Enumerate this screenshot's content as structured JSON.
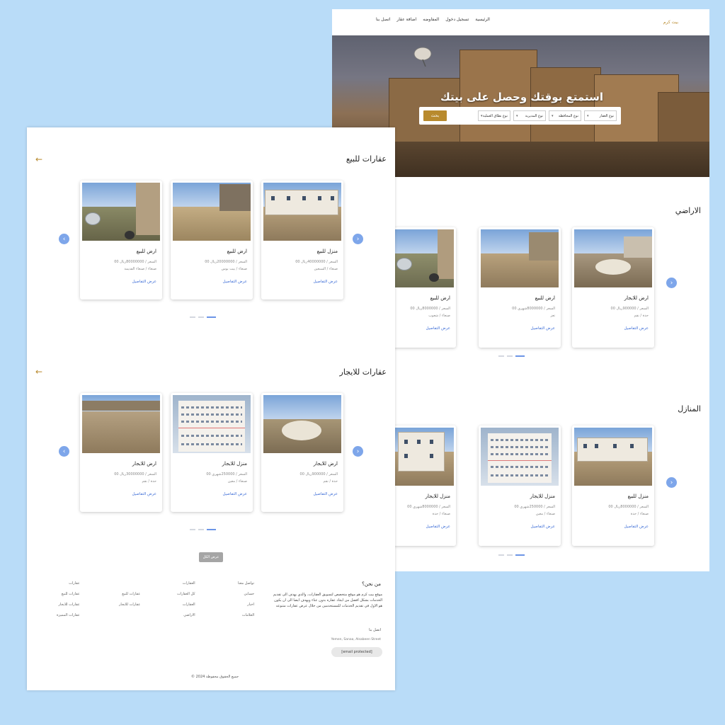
{
  "header": {
    "brand": "بيت كرم",
    "menu": [
      "الرئيسية",
      "تسجيل دخول",
      "المفاوضه",
      "اضافة عقار",
      "اتصل بنا"
    ]
  },
  "hero": {
    "title": "استمتع بوقتك وحصل على بيتك",
    "filters": [
      "نوع العقار",
      "نوع المحافظة",
      "نوع المديرية",
      "نوع نطاق العملية"
    ],
    "search_label": "بحث"
  },
  "back_sections": {
    "lands": {
      "title": "الاراضي",
      "cards": [
        {
          "title": "ارض للايجار",
          "price": "السعر / 900000ريال 00",
          "location": "حدة / نقم",
          "link": "عرض التفاصيل"
        },
        {
          "title": "ارض للبيع",
          "price": "السعر / 8000000شهري 00",
          "location": "تعز",
          "link": "عرض التفاصيل"
        },
        {
          "title": "ارض للبيع",
          "price": "السعر / 8000000ريال 00",
          "location": "صنعاء / شعوب",
          "link": "عرض التفاصيل"
        }
      ]
    },
    "houses": {
      "title": "المنازل",
      "cards": [
        {
          "title": "منزل للبيع",
          "price": "السعر / 8000000ريال 00",
          "location": "صنعاء / حدة",
          "link": "عرض التفاصيل"
        },
        {
          "title": "منزل للايجار",
          "price": "السعر / 250000شهري 00",
          "location": "صنعاء / معين",
          "link": "عرض التفاصيل"
        },
        {
          "title": "منزل للايجار",
          "price": "السعر / 8000000شهري 00",
          "location": "صنعاء / حدة",
          "link": "عرض التفاصيل"
        }
      ]
    }
  },
  "front_sections": {
    "sale": {
      "title": "عقارات للبيع",
      "cards": [
        {
          "title": "منزل للبيع",
          "price": "السعر / 40000000ريال 00",
          "location": "صنعاء / السبعين",
          "link": "عرض التفاصيل"
        },
        {
          "title": "ارض للبيع",
          "price": "السعر / 20000000ريال 00",
          "location": "صنعاء / بيت بوس",
          "link": "عرض التفاصيل"
        },
        {
          "title": "ارض للبيع",
          "price": "السعر / 80000000ريال 00",
          "location": "صنعاء / صنعاء القديمة",
          "link": "عرض التفاصيل"
        }
      ]
    },
    "rent": {
      "title": "عقارات للايجار",
      "cards": [
        {
          "title": "ارض للايجار",
          "price": "السعر / 900000ريال 00",
          "location": "حدة / نقم",
          "link": "عرض التفاصيل"
        },
        {
          "title": "منزل للايجار",
          "price": "السعر / 250000شهري 00",
          "location": "صنعاء / معين",
          "link": "عرض التفاصيل"
        },
        {
          "title": "ارض للايجار",
          "price": "السعر / 30000000ريال 00",
          "location": "حدة / نقم",
          "link": "عرض التفاصيل"
        }
      ]
    },
    "more_button": "عرض الكل"
  },
  "footer": {
    "about_title": "من نحن؟",
    "about_text": "موقع بيت كرم هو موقع متخصص لتسويق العقارات، والذي يهدف الى تقديم الخدمات بشكل افضل من ايجاد عقاره بدون عناء ويهدف ايضا الى ان يكون هو الاول في تقديم الخدمات للمستخدمين من خلال عرض عقارات متنوعه",
    "contact_label": "اتصل بنا",
    "address": "Yemen, Sanaa, Alsabeen Street",
    "email": "[email protected]",
    "links_col1": [
      "تواصل معنا",
      "حسابي",
      "اخبار",
      "العلامات"
    ],
    "links_col2": [
      "العقارات",
      "كل العقارات",
      "العقارات",
      "الاراضي"
    ],
    "links_col3": [
      "عقارات للبيع",
      "عقارات للايجار"
    ],
    "links_col4": [
      "عقارات",
      "عقارات للبيع",
      "عقارات للايجار",
      "عقارات المميزة"
    ],
    "copyright": "© 2024 جميع الحقوق محفوظة"
  }
}
